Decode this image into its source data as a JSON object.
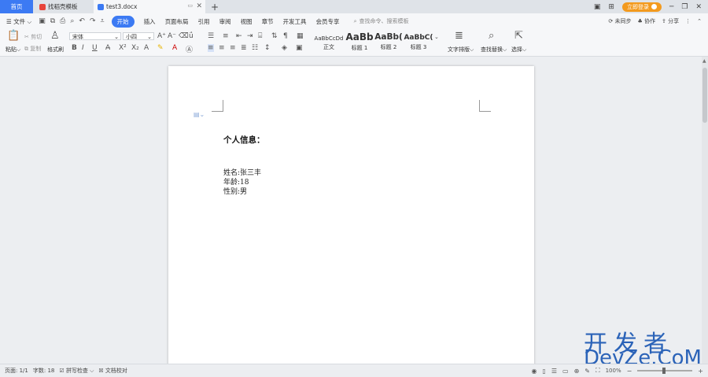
{
  "tabs": {
    "home": "首页",
    "template": "找稻壳模板",
    "document": "test3.docx",
    "new_tab": "+"
  },
  "window": {
    "login": "立即登录",
    "ctrl_icons": [
      "layout-icon",
      "grid-icon",
      "minimize-icon",
      "restore-icon",
      "close-icon"
    ]
  },
  "menu": {
    "file": "文件",
    "items": [
      "开始",
      "插入",
      "页面布局",
      "引用",
      "审阅",
      "视图",
      "章节",
      "开发工具",
      "会员专享"
    ],
    "active_index": 0,
    "search": "查找命令、搜索模板",
    "right": [
      "未同步",
      "协作",
      "分享"
    ]
  },
  "ribbon": {
    "paste": "粘贴",
    "cut": "剪切",
    "copy": "复制",
    "format_painter": "格式刷",
    "font_name": "宋体",
    "font_size": "小四",
    "styles": [
      {
        "preview": "AaBbCcDd",
        "label": "正文"
      },
      {
        "preview": "AaBb",
        "label": "标题 1"
      },
      {
        "preview": "AaBb(",
        "label": "标题 2"
      },
      {
        "preview": "AaBbC(",
        "label": "标题 3"
      }
    ],
    "text_layout": "文字排版",
    "find_replace": "查找替换",
    "select": "选择"
  },
  "document": {
    "heading": "个人信息：",
    "lines": [
      "姓名:张三丰",
      "年龄:18",
      "性别:男"
    ]
  },
  "status": {
    "page": "页面: 1/1",
    "words": "字数: 18",
    "spell": "拼写检查",
    "proof": "文档校对",
    "zoom": "100%",
    "zoom_value": 100
  },
  "watermark": {
    "line1": "开发者",
    "line2": "DevZe.CoM"
  },
  "colors": {
    "accent": "#3c7af3",
    "login": "#f39a1e",
    "watermark": "#2b63b8"
  }
}
